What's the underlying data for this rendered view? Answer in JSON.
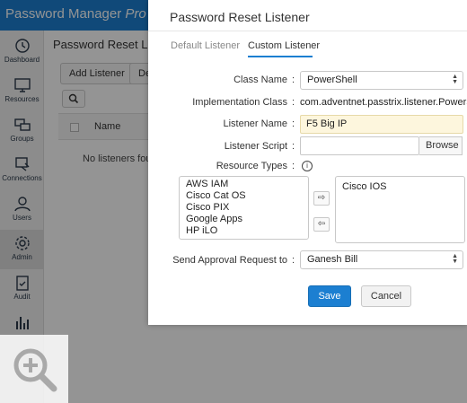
{
  "app": {
    "brand": "Password Manager Pro",
    "brand_main": "Password Manager ",
    "brand_suffix": "Pro"
  },
  "sidebar": {
    "items": [
      {
        "label": "Dashboard",
        "icon": "clock-icon"
      },
      {
        "label": "Resources",
        "icon": "monitor-icon"
      },
      {
        "label": "Groups",
        "icon": "groups-icon"
      },
      {
        "label": "Connections",
        "icon": "connections-icon"
      },
      {
        "label": "Users",
        "icon": "user-icon"
      },
      {
        "label": "Admin",
        "icon": "gear-icon",
        "active": true
      },
      {
        "label": "Audit",
        "icon": "clipboard-icon"
      },
      {
        "label": "",
        "icon": "bar-chart-icon"
      }
    ]
  },
  "background": {
    "page_title": "Password Reset Liste",
    "add_listener_label": "Add Listener",
    "second_button_label": "De",
    "table_name_header": "Name",
    "empty_message": "No listeners foun"
  },
  "modal": {
    "title": "Password Reset Listener",
    "tabs": [
      {
        "label": "Default Listener",
        "active": false
      },
      {
        "label": "Custom Listener",
        "active": true
      }
    ],
    "class_name": {
      "label": "Class Name",
      "value": "PowerShell"
    },
    "implementation_class": {
      "label": "Implementation Class",
      "value": "com.adventnet.passtrix.listener.PowerShe"
    },
    "listener_name": {
      "label": "Listener Name",
      "value": "F5 Big IP"
    },
    "listener_script": {
      "label": "Listener Script",
      "value": "",
      "browse_label": "Browse"
    },
    "resource_types": {
      "label": "Resource Types",
      "available": [
        "AWS IAM",
        "Cisco Cat OS",
        "Cisco PIX",
        "Google Apps",
        "HP iLO"
      ],
      "selected": [
        "Cisco IOS"
      ],
      "move_right_symbol": "⇨",
      "move_left_symbol": "⇦"
    },
    "approval": {
      "label": "Send Approval Request to",
      "value": "Ganesh Bill"
    },
    "save_label": "Save",
    "cancel_label": "Cancel"
  },
  "colon": ":",
  "colors": {
    "brand_blue": "#1c7fd1",
    "highlight_input": "#fdf6dd"
  }
}
